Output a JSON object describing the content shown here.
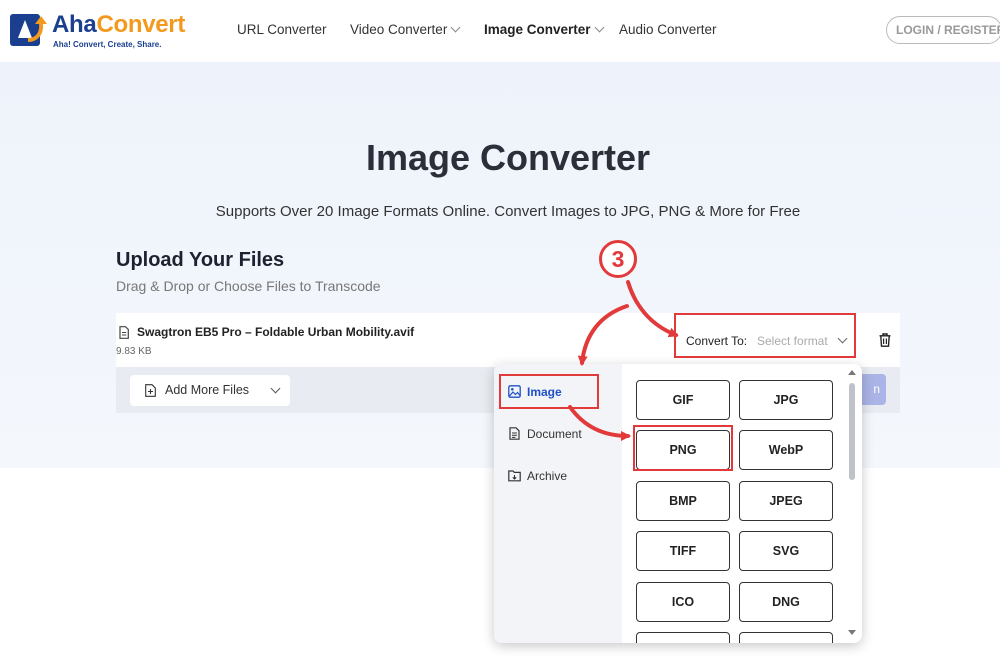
{
  "brand": {
    "name_part1": "Aha",
    "name_part2": "Convert",
    "tagline": "Aha! Convert, Create, Share.",
    "primary_color": "#1a3f8f",
    "accent_color": "#f39a1e"
  },
  "nav": {
    "items": [
      {
        "label": "URL Converter"
      },
      {
        "label": "Video Converter"
      },
      {
        "label": "Image Converter"
      },
      {
        "label": "Audio Converter"
      }
    ],
    "login_label": "LOGIN / REGISTER"
  },
  "hero": {
    "title": "Image Converter",
    "subtitle": "Supports Over 20 Image Formats Online. Convert Images to JPG, PNG & More for Free"
  },
  "upload": {
    "title": "Upload Your Files",
    "subtitle": "Drag & Drop or Choose Files to Transcode"
  },
  "file": {
    "name": "Swagtron EB5 Pro – Foldable Urban Mobility.avif",
    "size": "9.83 KB",
    "convert_label": "Convert To:",
    "select_placeholder": "Select format"
  },
  "actions": {
    "add_more_label": "Add More Files",
    "convert_label": "n"
  },
  "dropdown": {
    "categories": [
      {
        "label": "Image"
      },
      {
        "label": "Document"
      },
      {
        "label": "Archive"
      }
    ],
    "formats": [
      "GIF",
      "JPG",
      "PNG",
      "WebP",
      "BMP",
      "JPEG",
      "TIFF",
      "SVG",
      "ICO",
      "DNG"
    ]
  },
  "annotation": {
    "step_number": "3",
    "highlight_color": "#e23a3a"
  }
}
